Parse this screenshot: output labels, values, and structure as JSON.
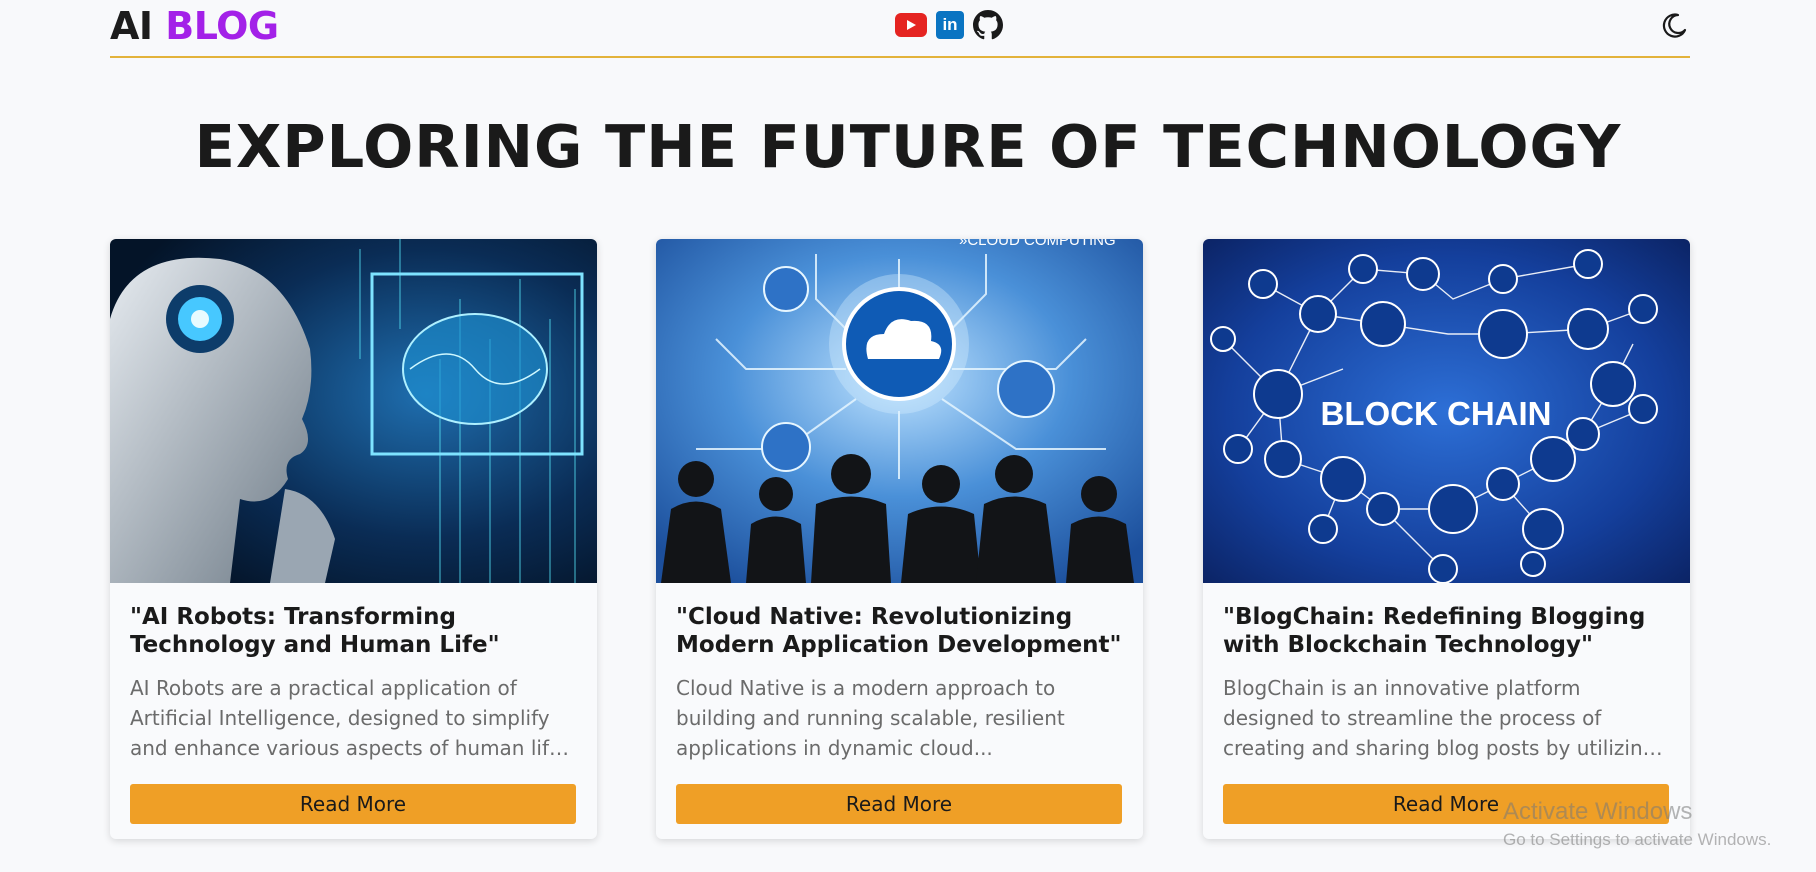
{
  "header": {
    "logo_ai": "AI",
    "logo_blog": "BLOG",
    "social_icons": [
      "youtube-icon",
      "linkedin-icon",
      "github-icon"
    ],
    "linkedin_text": "in",
    "theme_icon": "moon-icon"
  },
  "colors": {
    "brand_purple": "#a321e8",
    "accent_gold": "#e3b33b",
    "button_orange": "#ef9f26",
    "youtube_red": "#e52421",
    "linkedin_blue": "#0a74c2"
  },
  "hero": {
    "title": "EXPLORING THE FUTURE OF TECHNOLOGY"
  },
  "cards": [
    {
      "image": "ai-robot-brain-image",
      "title": "\"AI Robots: Transforming Technology and Human Life\"",
      "desc_lines": [
        "AI Robots are a practical application of",
        "Artificial Intelligence, designed to simplify",
        "and enhance various aspects of human life...."
      ],
      "button": "Read More"
    },
    {
      "image": "cloud-computing-image",
      "image_text": "»CLOUD COMPUTING",
      "title": "\"Cloud Native: Revolutionizing Modern Application Development\"",
      "desc_lines": [
        "Cloud Native is a modern approach to",
        "building and running scalable, resilient",
        "applications in dynamic cloud..."
      ],
      "button": "Read More"
    },
    {
      "image": "blockchain-network-image",
      "image_text": "BLOCK CHAIN",
      "title": "\"BlogChain: Redefining Blogging with Blockchain Technology\"",
      "desc_lines": [
        "BlogChain is an innovative platform",
        "designed to streamline the process of",
        "creating and sharing blog posts by utilizing..."
      ],
      "button": "Read More"
    }
  ],
  "watermark": {
    "line1": "Activate Windows",
    "line2": "Go to Settings to activate Windows."
  }
}
